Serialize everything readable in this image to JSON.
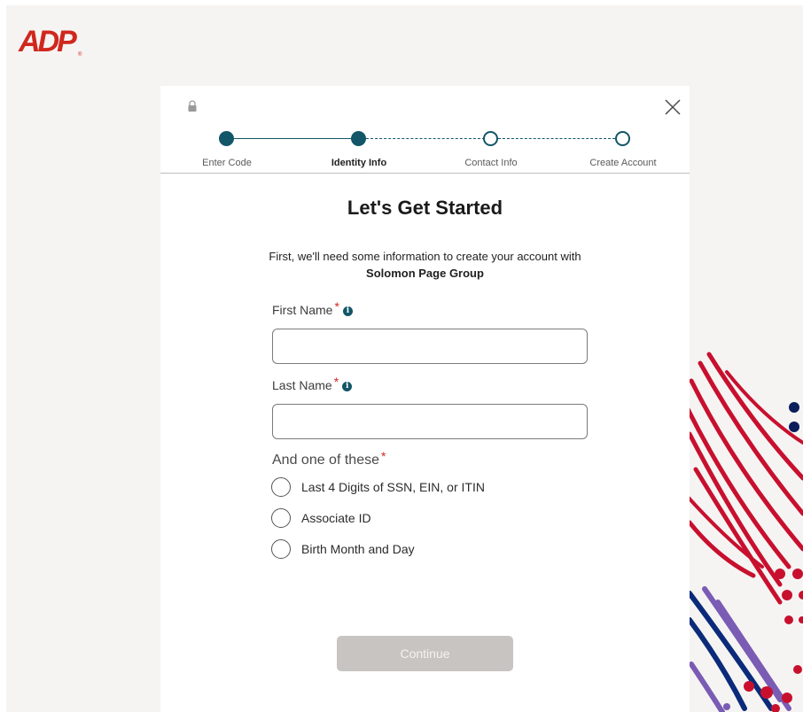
{
  "brand": {
    "logo_text": "ADP",
    "logo_color": "#d0271d"
  },
  "stepper": {
    "steps": [
      {
        "label": "Enter Code",
        "state": "complete"
      },
      {
        "label": "Identity Info",
        "state": "current"
      },
      {
        "label": "Contact Info",
        "state": "upcoming"
      },
      {
        "label": "Create Account",
        "state": "upcoming"
      }
    ],
    "accent_color": "#135667"
  },
  "icons": {
    "lock": "lock-icon",
    "close": "close-icon",
    "info": "info-icon"
  },
  "form": {
    "title": "Let's Get Started",
    "intro_line": "First, we'll need some information to create your account with",
    "company": "Solomon Page Group",
    "first_name": {
      "label": "First Name",
      "required_mark": "*",
      "value": "",
      "info_glyph": "i"
    },
    "last_name": {
      "label": "Last Name",
      "required_mark": "*",
      "value": "",
      "info_glyph": "i"
    },
    "one_of_label": "And one of these",
    "one_of_required_mark": "*",
    "options": [
      {
        "label": "Last 4 Digits of SSN, EIN, or ITIN",
        "selected": false
      },
      {
        "label": "Associate ID",
        "selected": false
      },
      {
        "label": "Birth Month and Day",
        "selected": false
      }
    ],
    "continue_label": "Continue",
    "continue_enabled": false
  },
  "colors": {
    "required": "#d0271d",
    "button_disabled": "#c8c4c1",
    "page_background": "#f5f4f3"
  }
}
